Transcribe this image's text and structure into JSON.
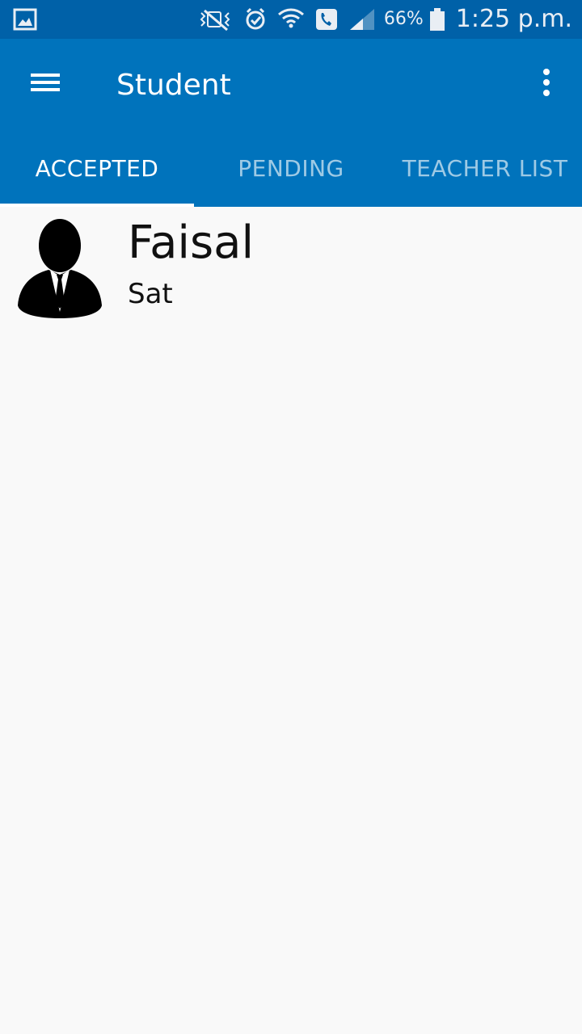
{
  "status_bar": {
    "battery": "66%",
    "time": "1:25 p.m.",
    "icons": [
      "gallery-icon",
      "vibrate-off-icon",
      "alarm-icon",
      "wifi-icon",
      "call-icon",
      "signal-icon",
      "battery-icon"
    ]
  },
  "app_bar": {
    "title": "Student",
    "background": "#0073bc",
    "status_background": "#0061a8"
  },
  "tabs": [
    {
      "label": "ACCEPTED",
      "active": true
    },
    {
      "label": "PENDING",
      "active": false
    },
    {
      "label": "TEACHER LIST",
      "active": false
    }
  ],
  "list": {
    "items": [
      {
        "name": "Faisal",
        "subtitle": "Sat",
        "icon": "person-avatar-icon"
      }
    ]
  }
}
